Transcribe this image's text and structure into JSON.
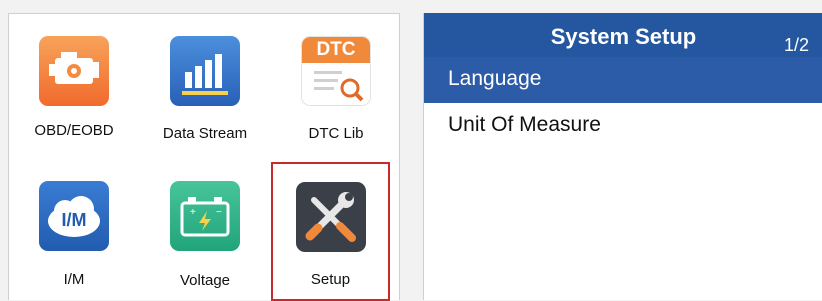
{
  "app_grid": {
    "tiles": [
      {
        "label": "OBD/EOBD",
        "icon": "engine-icon"
      },
      {
        "label": "Data Stream",
        "icon": "bar-chart-icon"
      },
      {
        "label": "DTC Lib",
        "icon": "dtc-search-icon",
        "icon_text": "DTC"
      },
      {
        "label": "I/M",
        "icon": "im-cloud-icon",
        "icon_text": "I/M"
      },
      {
        "label": "Voltage",
        "icon": "battery-icon"
      },
      {
        "label": "Setup",
        "icon": "wrench-screwdriver-icon",
        "selected": true
      }
    ]
  },
  "setup_screen": {
    "title": "System Setup",
    "page_indicator": "1/2",
    "items": [
      {
        "label": "Language",
        "selected": true
      },
      {
        "label": "Unit Of Measure",
        "selected": false
      }
    ]
  },
  "colors": {
    "header_blue": "#24579f",
    "highlight_blue": "#2c5ba8",
    "selection_red": "#c62a2a"
  }
}
